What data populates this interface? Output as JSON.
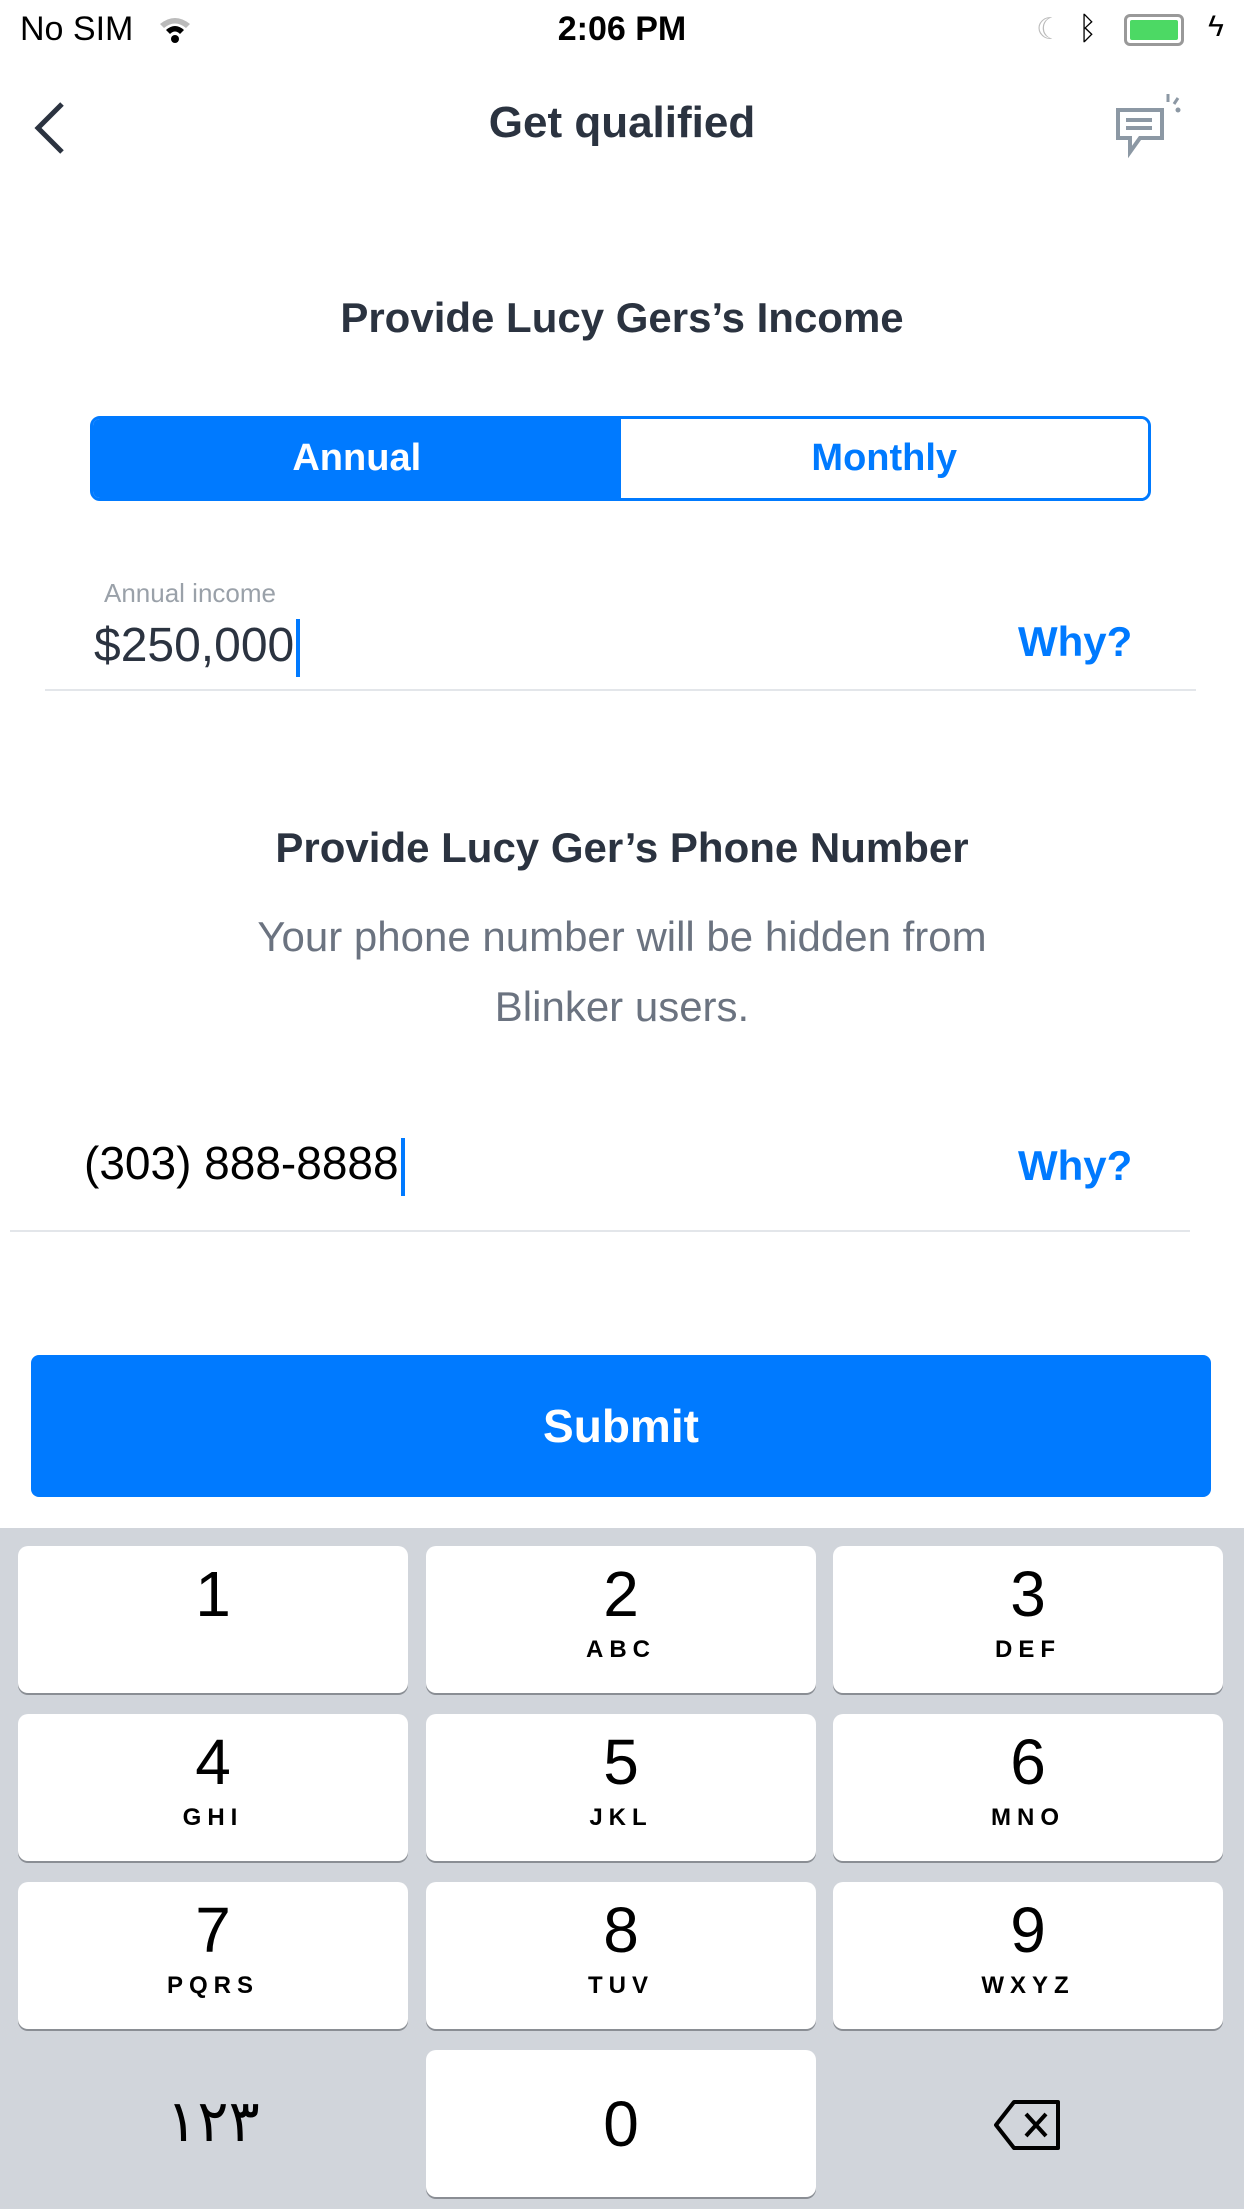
{
  "status_bar": {
    "carrier": "No SIM",
    "time": "2:06 PM"
  },
  "nav": {
    "title": "Get qualified"
  },
  "income": {
    "heading": "Provide Lucy Gers’s Income",
    "tabs": [
      {
        "label": "Annual",
        "selected": true
      },
      {
        "label": "Monthly",
        "selected": false
      }
    ],
    "field_label": "Annual income",
    "value": "$250,000",
    "why": "Why?"
  },
  "phone": {
    "heading": "Provide Lucy Ger’s Phone Number",
    "subtitle_line1": "Your phone number will be hidden from",
    "subtitle_line2": "Blinker users.",
    "value": "(303) 888-8888",
    "why": "Why?"
  },
  "submit_label": "Submit",
  "keyboard": {
    "keys": [
      {
        "digit": "1",
        "letters": ""
      },
      {
        "digit": "2",
        "letters": "ABC"
      },
      {
        "digit": "3",
        "letters": "DEF"
      },
      {
        "digit": "4",
        "letters": "GHI"
      },
      {
        "digit": "5",
        "letters": "JKL"
      },
      {
        "digit": "6",
        "letters": "MNO"
      },
      {
        "digit": "7",
        "letters": "PQRS"
      },
      {
        "digit": "8",
        "letters": "TUV"
      },
      {
        "digit": "9",
        "letters": "WXYZ"
      }
    ],
    "alt": "١٢٣",
    "zero": "0"
  },
  "colors": {
    "accent": "#007aff",
    "battery": "#4cd964"
  }
}
